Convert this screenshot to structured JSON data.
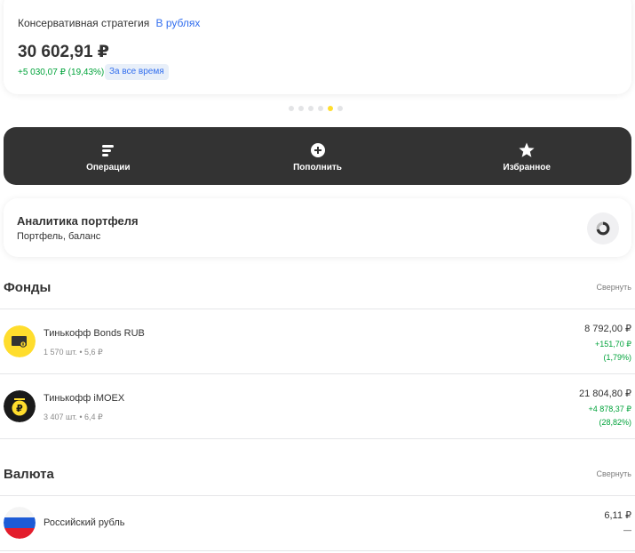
{
  "summary": {
    "strategy_label": "Консервативная стратегия",
    "currency_link": "В рублях",
    "amount": "30 602,91 ₽",
    "change": "+5 030,07 ₽ (19,43%)",
    "period_badge": "За все время"
  },
  "carousel": {
    "dot_count": 6,
    "active_index": 4
  },
  "actions": {
    "operations": "Операции",
    "top_up": "Пополнить",
    "favorites": "Избранное"
  },
  "analytics": {
    "title": "Аналитика портфеля",
    "subtitle": "Портфель, баланс"
  },
  "funds": {
    "title": "Фонды",
    "collapse": "Свернуть",
    "items": [
      {
        "name": "Тинькофф Bonds RUB",
        "meta": "1 570 шт. • 5,6 ₽",
        "value": "8 792,00 ₽",
        "gain": "+151,70 ₽",
        "gain_pct": "(1,79%)"
      },
      {
        "name": "Тинькофф iMOEX",
        "meta": "3 407 шт. • 6,4 ₽",
        "value": "21 804,80 ₽",
        "gain": "+4 878,37 ₽",
        "gain_pct": "(28,82%)"
      }
    ]
  },
  "currency": {
    "title": "Валюта",
    "collapse": "Свернуть",
    "items": [
      {
        "name": "Российский рубль",
        "value": "6,11 ₽",
        "gain": "—"
      }
    ]
  },
  "colors": {
    "accent": "#ffdd2d",
    "positive": "#00a33a",
    "link": "#336fee",
    "dark": "#333333"
  }
}
